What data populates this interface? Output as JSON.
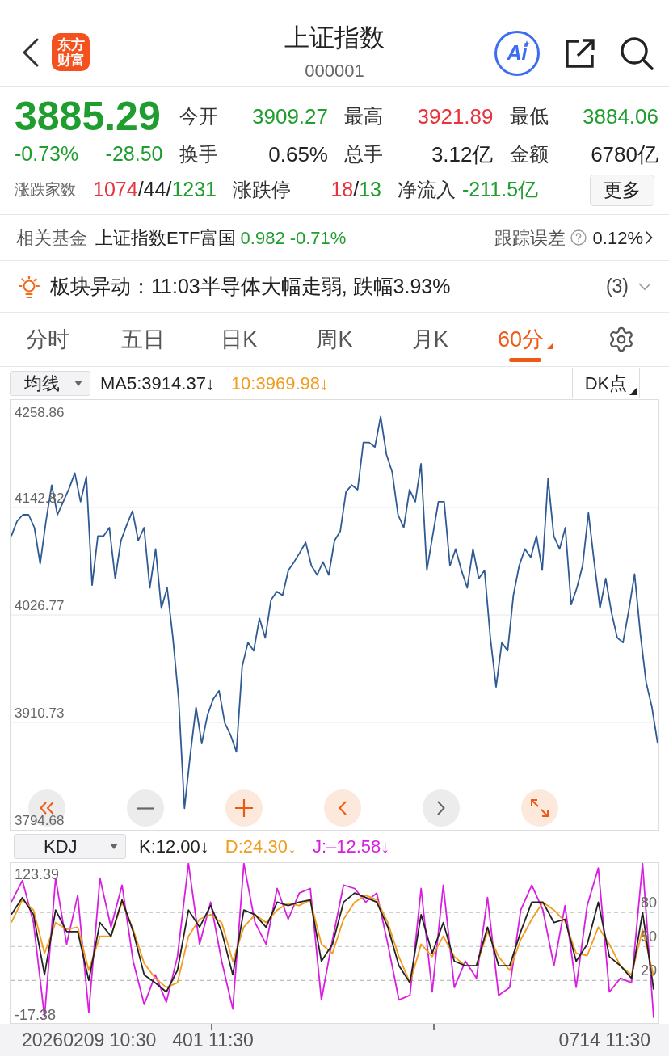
{
  "header": {
    "logo_lines": [
      "东方",
      "财富"
    ],
    "title": "上证指数",
    "code": "000001",
    "ai_label": "Ai"
  },
  "quote": {
    "price": {
      "text": "3885.29",
      "color": "#1f9d2f"
    },
    "changes": [
      {
        "text": "-0.73%",
        "color": "#1f9d2f"
      },
      {
        "text": "-28.50",
        "color": "#1f9d2f"
      }
    ],
    "stats": [
      {
        "label": "今开",
        "value": "3909.27",
        "color": "#1f9d2f"
      },
      {
        "label": "最高",
        "value": "3921.89",
        "color": "#e8323c"
      },
      {
        "label": "最低",
        "value": "3884.06",
        "color": "#1f9d2f"
      },
      {
        "label": "换手",
        "value": "0.65%",
        "color": "#222222"
      },
      {
        "label": "总手",
        "value": "3.12亿",
        "color": "#222222"
      },
      {
        "label": "金额",
        "value": "6780亿",
        "color": "#222222"
      }
    ],
    "breadth": {
      "label": "涨跌家数",
      "parts": [
        {
          "text": "1074",
          "color": "#e8323c"
        },
        {
          "text": "/44/",
          "color": "#222222"
        },
        {
          "text": "1231",
          "color": "#1f9d2f"
        }
      ]
    },
    "limits": {
      "label": "涨跌停",
      "parts": [
        {
          "text": "18",
          "color": "#e8323c"
        },
        {
          "text": "/",
          "color": "#222222"
        },
        {
          "text": "13",
          "color": "#1f9d2f"
        }
      ]
    },
    "net_inflow": {
      "label": "净流入",
      "value": "-211.5亿",
      "color": "#1f9d2f"
    },
    "more_button": "更多"
  },
  "fund": {
    "label": "相关基金",
    "name": "上证指数ETF富国",
    "quotes": [
      {
        "text": "0.982",
        "color": "#1f9d2f"
      },
      {
        "text": "-0.71%",
        "color": "#1f9d2f"
      }
    ],
    "tracking_label": "跟踪误差",
    "tracking_value": "0.12%"
  },
  "alert": {
    "text": "板块异动：11:03半导体大幅走弱, 跌幅3.93%",
    "count": "(3)",
    "expanded": false
  },
  "period_tabs": [
    {
      "label": "分时",
      "selected": false,
      "menu": false
    },
    {
      "label": "五日",
      "selected": false,
      "menu": false
    },
    {
      "label": "日K",
      "selected": false,
      "menu": false
    },
    {
      "label": "周K",
      "selected": false,
      "menu": false
    },
    {
      "label": "月K",
      "selected": false,
      "menu": false
    },
    {
      "label": "60分",
      "selected": true,
      "menu": true
    }
  ],
  "main_indicator": {
    "selector": "均线",
    "readings": [
      {
        "text": "MA5:3914.37↓",
        "color": "#222222"
      },
      {
        "text": "10:3969.98↓",
        "color": "#f29c1f"
      }
    ],
    "mode_button": "DK点"
  },
  "main_chart": {
    "range_labels": {
      "high": "4258.86",
      "low": "3794.68"
    },
    "chart_data": {
      "type": "line",
      "grid": true,
      "ylim": [
        3794.68,
        4258.86
      ],
      "yticks": [
        3910.73,
        4026.77,
        4142.82
      ],
      "series": [
        {
          "color": "#2f5a94",
          "values": [
            4112,
            4128,
            4135,
            4135,
            4121,
            4082,
            4128,
            4167,
            4135,
            4149,
            4163,
            4180,
            4149,
            4176,
            4059,
            4112,
            4112,
            4121,
            4066,
            4107,
            4124,
            4139,
            4107,
            4121,
            4056,
            4098,
            4034,
            4056,
            4002,
            3936,
            3818,
            3875,
            3927,
            3888,
            3919,
            3936,
            3945,
            3910,
            3897,
            3879,
            3971,
            3997,
            3988,
            4023,
            4002,
            4043,
            4052,
            4048,
            4075,
            4084,
            4094,
            4105,
            4080,
            4070,
            4084,
            4070,
            4107,
            4117,
            4160,
            4167,
            4162,
            4213,
            4213,
            4208,
            4241,
            4200,
            4181,
            4135,
            4121,
            4162,
            4149,
            4190,
            4075,
            4112,
            4149,
            4149,
            4080,
            4098,
            4075,
            4056,
            4098,
            4066,
            4075,
            4002,
            3949,
            3997,
            3988,
            4048,
            4080,
            4098,
            4089,
            4112,
            4075,
            4174,
            4112,
            4098,
            4121,
            4038,
            4056,
            4080,
            4137,
            4084,
            4034,
            4066,
            4029,
            4002,
            3997,
            4032,
            4071,
            4006,
            3954,
            3927,
            3888
          ]
        }
      ]
    },
    "controls": [
      {
        "kind": "rewind",
        "disabled": false
      },
      {
        "kind": "zoom_out",
        "disabled": true
      },
      {
        "kind": "zoom_in",
        "disabled": false
      },
      {
        "kind": "back",
        "disabled": false
      },
      {
        "kind": "forward",
        "disabled": true
      },
      {
        "kind": "fullscreen",
        "disabled": false
      }
    ]
  },
  "sub_indicator": {
    "selector": "KDJ",
    "readings": [
      {
        "text": "K:12.00↓",
        "color": "#222222"
      },
      {
        "text": "D:24.30↓",
        "color": "#f29c1f"
      },
      {
        "text": "J:–12.58↓",
        "color": "#d81ee0"
      }
    ]
  },
  "sub_chart": {
    "range_labels": {
      "high": "123.39",
      "low": "-17.38"
    },
    "chart_data": {
      "type": "line",
      "grid": true,
      "ylim": [
        -17.38,
        123.39
      ],
      "yticks": [
        20,
        50,
        80
      ],
      "series": [
        {
          "color": "#222222",
          "values": [
            78,
            93,
            78,
            25,
            82,
            63,
            63,
            20,
            71,
            59,
            91,
            63,
            25,
            18,
            10,
            29,
            82,
            67,
            86,
            63,
            25,
            82,
            78,
            67,
            89,
            86,
            89,
            91,
            37,
            52,
            89,
            97,
            93,
            89,
            67,
            33,
            18,
            78,
            44,
            71,
            37,
            33,
            33,
            67,
            33,
            33,
            63,
            89,
            89,
            71,
            74,
            37,
            52,
            89,
            41,
            33,
            22,
            80,
            12
          ]
        },
        {
          "color": "#f29c1f",
          "values": [
            71,
            91,
            82,
            44,
            71,
            65,
            67,
            29,
            59,
            59,
            89,
            65,
            35,
            22,
            14,
            18,
            59,
            74,
            78,
            71,
            37,
            67,
            78,
            71,
            82,
            88,
            86,
            91,
            52,
            44,
            74,
            89,
            95,
            91,
            71,
            41,
            18,
            52,
            41,
            59,
            41,
            33,
            33,
            63,
            41,
            29,
            56,
            74,
            89,
            82,
            72,
            44,
            42,
            67,
            52,
            33,
            25,
            65,
            24
          ]
        },
        {
          "color": "#d81ee0",
          "values": [
            89,
            108,
            71,
            -12,
            110,
            52,
            95,
            -8,
            110,
            67,
            104,
            37,
            -1,
            25,
            1,
            41,
            123,
            52,
            89,
            37,
            -5,
            123,
            71,
            52,
            101,
            74,
            97,
            101,
            3,
            56,
            104,
            101,
            89,
            97,
            52,
            3,
            7,
            101,
            10,
            104,
            14,
            37,
            22,
            93,
            7,
            14,
            82,
            104,
            82,
            33,
            86,
            14,
            86,
            119,
            10,
            22,
            18,
            123,
            -13
          ]
        }
      ]
    }
  },
  "time_axis": {
    "labels": [
      "20260209 10:30",
      "401 11:30",
      "0714 11:30"
    ]
  }
}
